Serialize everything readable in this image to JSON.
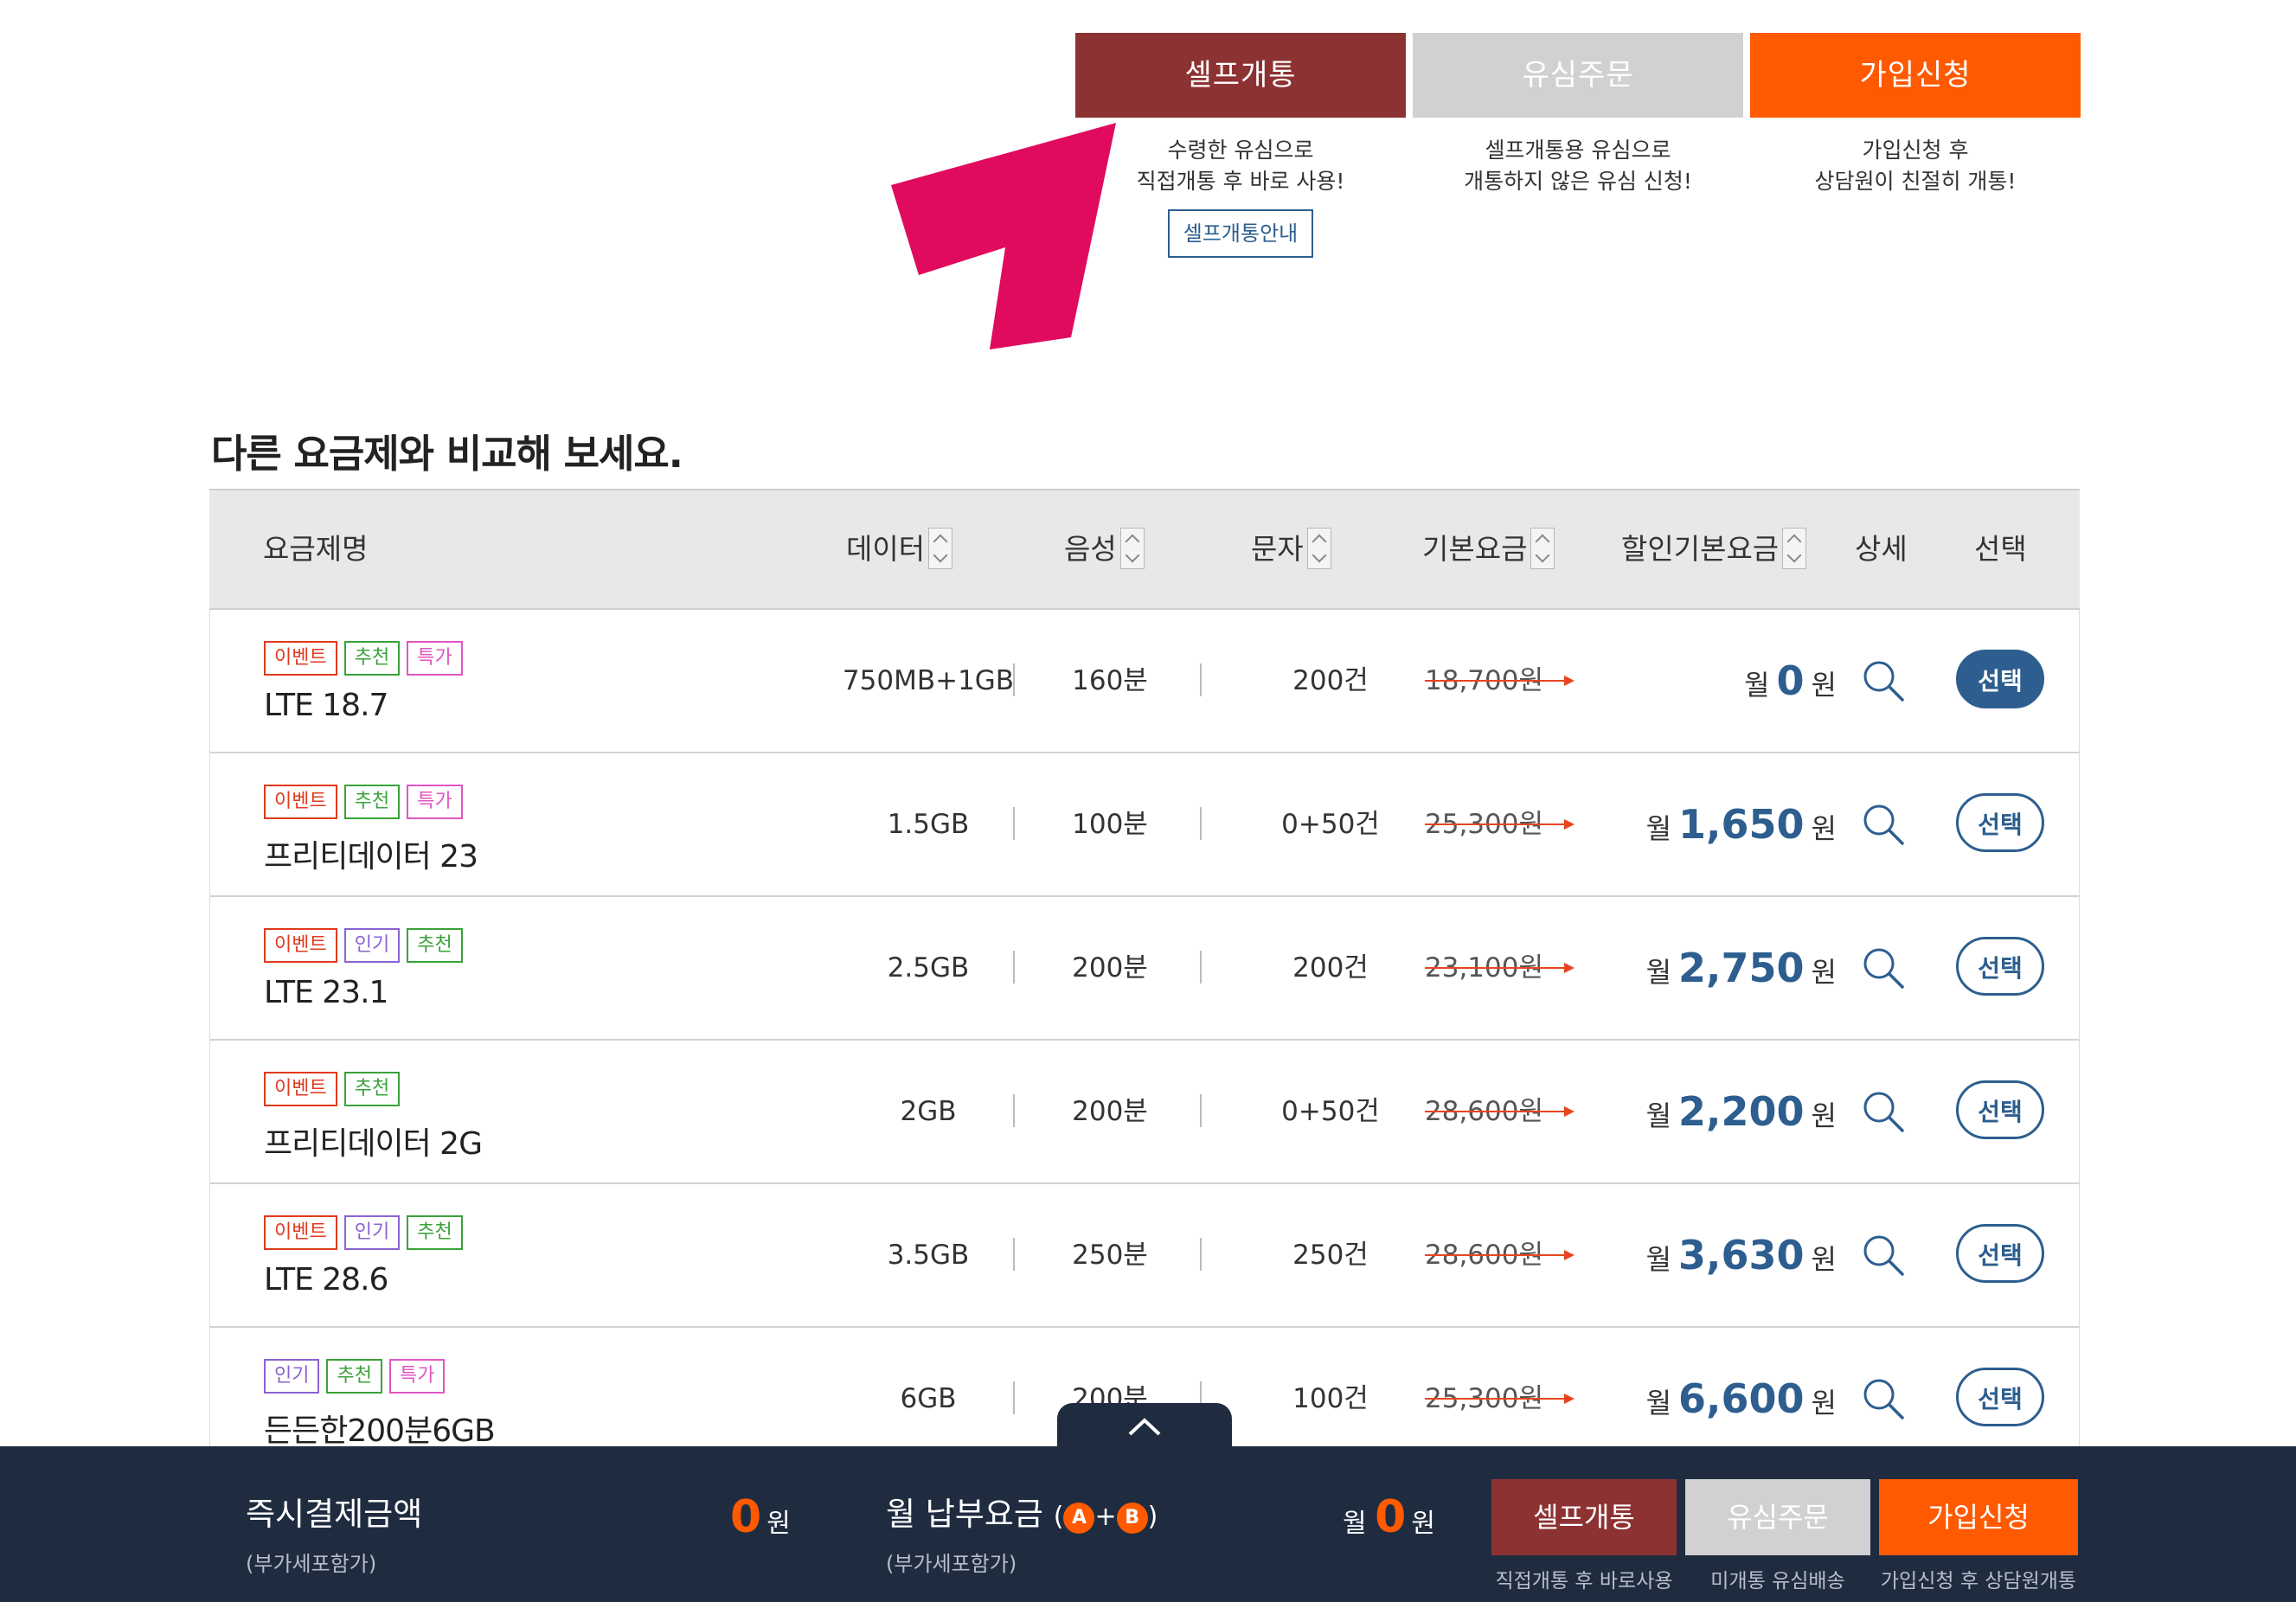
{
  "options": [
    {
      "label": "셀프개통",
      "color": "#8d3233",
      "desc1": "수령한 유심으로",
      "desc2": "직접개통 후 바로 사용!",
      "guide": "셀프개통안내"
    },
    {
      "label": "유심주문",
      "color": "#d1d1d1",
      "desc1": "셀프개통용 유심으로",
      "desc2": "개통하지 않은 유심 신청!"
    },
    {
      "label": "가입신청",
      "color": "#ff5a00",
      "desc1": "가입신청 후",
      "desc2": "상담원이 친절히 개통!"
    }
  ],
  "section_title": "다른 요금제와 비교해 보세요.",
  "table": {
    "headers": {
      "name": "요금제명",
      "data": "데이터",
      "voice": "음성",
      "sms": "문자",
      "base": "기본요금",
      "discount": "할인기본요금",
      "detail": "상세",
      "select": "선택"
    },
    "rows": [
      {
        "tags": [
          [
            "이벤트",
            "event"
          ],
          [
            "추천",
            "rec"
          ],
          [
            "특가",
            "sale"
          ]
        ],
        "name": "LTE 18.7",
        "data": "750MB+1GB",
        "voice": "160분",
        "sms": "200건",
        "base": "18,700원",
        "month_prefix": "월",
        "amount": "0",
        "unit": "원",
        "select": "선택",
        "active": true
      },
      {
        "tags": [
          [
            "이벤트",
            "event"
          ],
          [
            "추천",
            "rec"
          ],
          [
            "특가",
            "sale"
          ]
        ],
        "name": "프리티데이터 23",
        "data": "1.5GB",
        "voice": "100분",
        "sms": "0+50건",
        "base": "25,300원",
        "month_prefix": "월",
        "amount": "1,650",
        "unit": "원",
        "select": "선택",
        "active": false
      },
      {
        "tags": [
          [
            "이벤트",
            "event"
          ],
          [
            "인기",
            "pop"
          ],
          [
            "추천",
            "rec"
          ]
        ],
        "name": "LTE 23.1",
        "data": "2.5GB",
        "voice": "200분",
        "sms": "200건",
        "base": "23,100원",
        "month_prefix": "월",
        "amount": "2,750",
        "unit": "원",
        "select": "선택",
        "active": false
      },
      {
        "tags": [
          [
            "이벤트",
            "event"
          ],
          [
            "추천",
            "rec"
          ]
        ],
        "name": "프리티데이터 2G",
        "data": "2GB",
        "voice": "200분",
        "sms": "0+50건",
        "base": "28,600원",
        "month_prefix": "월",
        "amount": "2,200",
        "unit": "원",
        "select": "선택",
        "active": false
      },
      {
        "tags": [
          [
            "이벤트",
            "event"
          ],
          [
            "인기",
            "pop"
          ],
          [
            "추천",
            "rec"
          ]
        ],
        "name": "LTE 28.6",
        "data": "3.5GB",
        "voice": "250분",
        "sms": "250건",
        "base": "28,600원",
        "month_prefix": "월",
        "amount": "3,630",
        "unit": "원",
        "select": "선택",
        "active": false
      },
      {
        "tags": [
          [
            "인기",
            "pop"
          ],
          [
            "추천",
            "rec"
          ],
          [
            "특가",
            "sale"
          ]
        ],
        "name": "든든한200분6GB",
        "data": "6GB",
        "voice": "200분",
        "sms": "100건",
        "base": "25,300원",
        "month_prefix": "월",
        "amount": "6,600",
        "unit": "원",
        "select": "선택",
        "active": false
      }
    ]
  },
  "bottom": {
    "instant_title": "즉시결제금액",
    "instant_sub": "(부가세포함가)",
    "instant_amount": "0",
    "instant_unit": "원",
    "monthly_title": "월 납부요금",
    "monthly_a": "A",
    "monthly_b": "B",
    "monthly_sub": "(부가세포함가)",
    "monthly_prefix": "월",
    "monthly_amount": "0",
    "monthly_unit": "원",
    "buttons": [
      {
        "label": "셀프개통",
        "sub": "직접개통 후 바로사용",
        "color": "#8d3233"
      },
      {
        "label": "유심주문",
        "sub": "미개통 유심배송",
        "color": "#d1d1d1"
      },
      {
        "label": "가입신청",
        "sub": "가입신청 후 상담원개통",
        "color": "#ff5a00"
      }
    ]
  }
}
